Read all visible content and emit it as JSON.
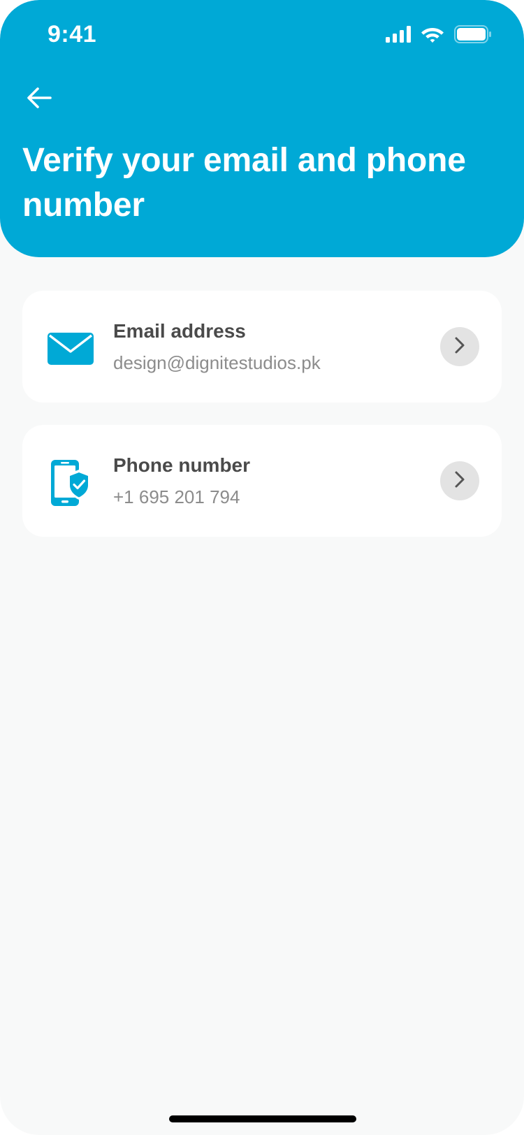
{
  "status_bar": {
    "time": "9:41",
    "icons": [
      "signal-icon",
      "wifi-icon",
      "battery-icon"
    ]
  },
  "header": {
    "back_icon": "back-arrow-icon",
    "title": "Verify your email and phone number"
  },
  "items": [
    {
      "icon": "envelope-icon",
      "label": "Email address",
      "value": "design@dignitestudios.pk",
      "action_icon": "chevron-right-icon"
    },
    {
      "icon": "phone-shield-icon",
      "label": "Phone number",
      "value": "+1 695 201 794",
      "action_icon": "chevron-right-icon"
    }
  ],
  "colors": {
    "brand": "#00a9d6",
    "background": "#f8f9f9",
    "card": "#ffffff",
    "label_text": "#4a4a4a",
    "value_text": "#8c8c8c",
    "chevron_bg": "#e3e3e3"
  }
}
